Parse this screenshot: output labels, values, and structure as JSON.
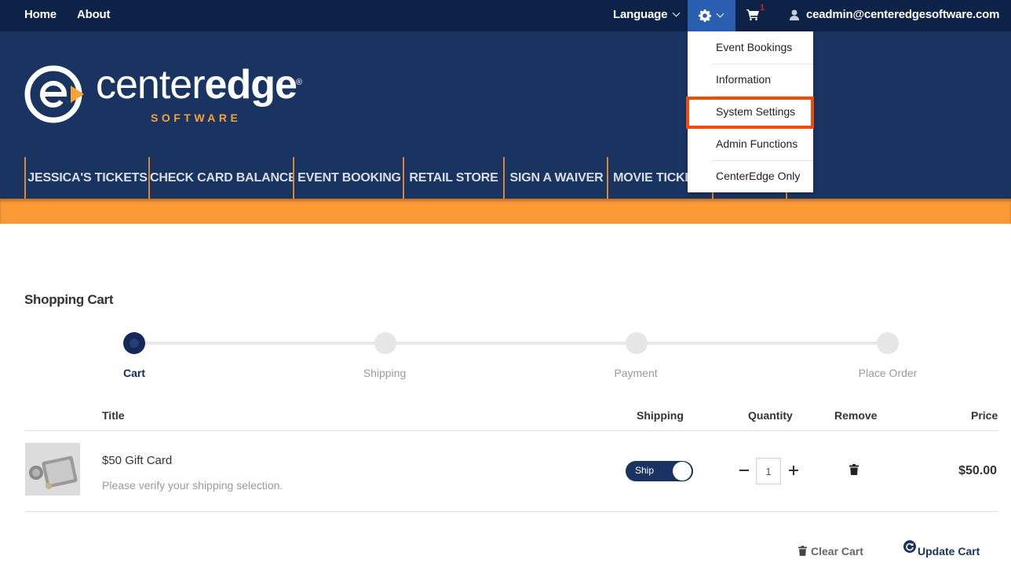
{
  "topbar": {
    "home": "Home",
    "about": "About",
    "language": "Language",
    "cart_count": "1",
    "user_email": "ceadmin@centeredgesoftware.com"
  },
  "logo": {
    "name_light": "center",
    "name_bold": "edge",
    "reg": "®",
    "sub": "SOFTWARE"
  },
  "nav": {
    "items": [
      "JESSICA'S TICKETS",
      "CHECK CARD BALANCE",
      "EVENT BOOKING",
      "RETAIL STORE",
      "SIGN A WAIVER",
      "MOVIE TICKETS",
      "",
      ""
    ]
  },
  "settings_menu": {
    "items": [
      "Event Bookings",
      "Information",
      "System Settings",
      "Admin Functions",
      "CenterEdge Only"
    ],
    "highlighted": "System Settings"
  },
  "cart": {
    "title": "Shopping Cart",
    "steps": [
      "Cart",
      "Shipping",
      "Payment",
      "Place Order"
    ],
    "active_step": "Cart",
    "columns": {
      "title": "Title",
      "shipping": "Shipping",
      "quantity": "Quantity",
      "remove": "Remove",
      "price": "Price"
    },
    "item": {
      "title": "$50 Gift Card",
      "note": "Please verify your shipping selection.",
      "shipping_toggle": "Ship",
      "quantity": "1",
      "price": "$50.00"
    },
    "clear_label": "Clear Cart",
    "update_label": "Update Cart"
  },
  "colors": {
    "topbar": "#0d2247",
    "header": "#1a3461",
    "accent_orange": "#fb9a35",
    "highlight": "#f04a0c",
    "gear_active": "#2a5fb0"
  }
}
